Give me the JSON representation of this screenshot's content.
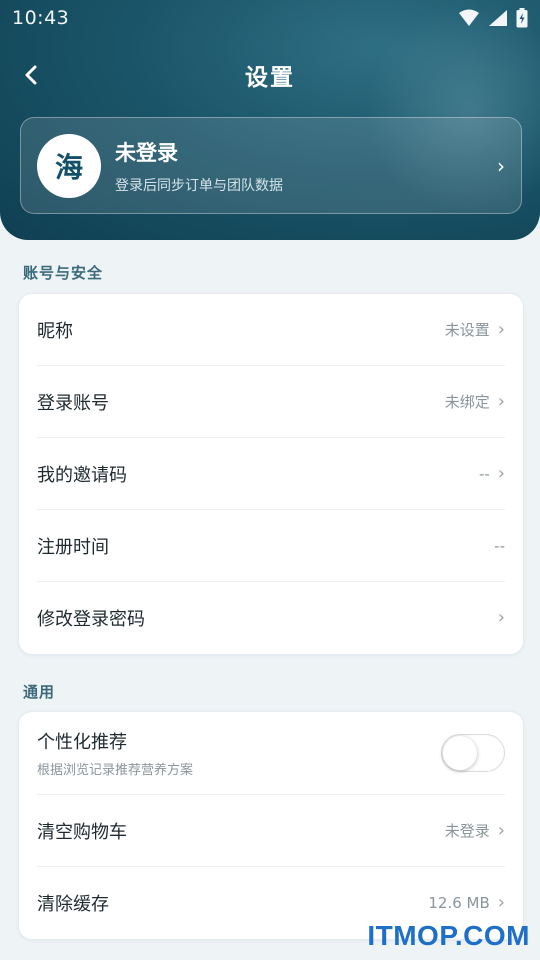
{
  "status_bar": {
    "time": "10:43"
  },
  "header": {
    "title": "设置"
  },
  "profile": {
    "avatar_char": "海",
    "name": "未登录",
    "subtitle": "登录后同步订单与团队数据"
  },
  "account_section": {
    "label": "账号与安全",
    "rows": [
      {
        "label": "昵称",
        "value": "未设置"
      },
      {
        "label": "登录账号",
        "value": "未绑定"
      },
      {
        "label": "我的邀请码",
        "value": "--"
      },
      {
        "label": "注册时间",
        "value": "--"
      },
      {
        "label": "修改登录密码",
        "value": ""
      }
    ]
  },
  "general_section": {
    "label": "通用",
    "personalized": {
      "label": "个性化推荐",
      "subtitle": "根据浏览记录推荐营养方案",
      "enabled": false
    },
    "rows": [
      {
        "label": "清空购物车",
        "value": "未登录"
      },
      {
        "label": "清除缓存",
        "value": "12.6 MB"
      }
    ]
  },
  "watermark": "ITMOP.COM",
  "icons": [
    "back-chevron-icon",
    "wifi-icon",
    "signal-icon",
    "battery-icon",
    "chevron-right-icon"
  ],
  "colors": {
    "header_dark": "#0f3f52",
    "accent_text": "#3c6a7b",
    "watermark_blue": "#1e6fc9"
  }
}
